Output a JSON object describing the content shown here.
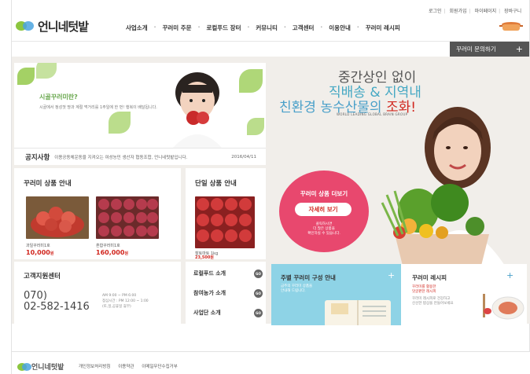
{
  "colors": {
    "accent_red": "#d1261e",
    "pink": "#e8486e",
    "sky": "#8ed3e6",
    "leaf_green": "#8dc63f",
    "title_blue": "#45a8c3"
  },
  "util_links": [
    "로그인",
    "회원가입",
    "마이페이지",
    "장바구니"
  ],
  "logo": {
    "text": "언니네텃밭",
    "icon": "leaf-logo-icon"
  },
  "nav": [
    "사업소개",
    "꾸러미 주문",
    "로컬푸드 장터",
    "커뮤니티",
    "고객센터",
    "이용안내",
    "꾸러미 레시피"
  ],
  "inquiry": {
    "label": "꾸러미 문의하기",
    "icon": "plus-icon"
  },
  "banner": {
    "title": "시골꾸러미란?",
    "desc": "시골에서 정성껏 땅과 계절 먹거리를 1주일에 한 번! 행복이 배달됩니다."
  },
  "notice": {
    "label": "공지사항",
    "text": "이용공동체운동을 지켜오는 여성농민 생산자 협동조합, 언니네텃밭입니다.",
    "date": "2016/04/11"
  },
  "kkurami": {
    "title": "꾸러미 상품 안내",
    "products": [
      {
        "name": "과일꾸러미1호",
        "price": "10,000",
        "unit": "원"
      },
      {
        "name": "혼합꾸러미1호",
        "price": "160,000",
        "unit": "원"
      }
    ]
  },
  "single": {
    "title": "단일 상품 안내",
    "product": {
      "name": "찰토마토 1kg",
      "price": "23,500",
      "unit": "원"
    }
  },
  "cs": {
    "title": "고객지원센터",
    "phone_prefix": "070)",
    "phone": "02-582-1416",
    "hours": [
      "AM 9:00 ~ PM 6:00",
      "점심시간 : PM 12:00 ~ 1:00",
      "(토,일,공휴일 휴무)"
    ]
  },
  "side_links": [
    {
      "label": "로컬푸드 소개",
      "go": "GO"
    },
    {
      "label": "참여농가 소개",
      "go": "GO"
    },
    {
      "label": "사업단 소개",
      "go": "GO"
    }
  ],
  "hero": {
    "line1": "중간상인 없이",
    "line2": "직배송 & 지역내",
    "line3a": "친환경 농수산물의",
    "line3b": "조화!",
    "sub": "WORLD LEADING GLOBAL BRAIN GROUP"
  },
  "circle": {
    "title": "꾸러미 상품 더보기",
    "button": "자세히 보기",
    "desc": [
      "클릭하시면",
      "더 많은 상품을",
      "확인하실 수 있습니다."
    ]
  },
  "weekly": {
    "title": "주별 꾸러미 구성 안내",
    "desc": [
      "금주의 꾸러미 상품을",
      "안내해 드립니다."
    ]
  },
  "recipe": {
    "title": "꾸러미 레시피",
    "desc1": [
      "꾸러미를 활용한",
      "맛글판한 레시피"
    ],
    "desc2": [
      "꾸러미 레시피로 건강하고",
      "신선한 밥상을 만들어보세요"
    ]
  },
  "footer": {
    "logo": "언니네텃밭",
    "links": [
      "개인정보처리방침",
      "이용약관",
      "이메일무단수집거부"
    ]
  }
}
